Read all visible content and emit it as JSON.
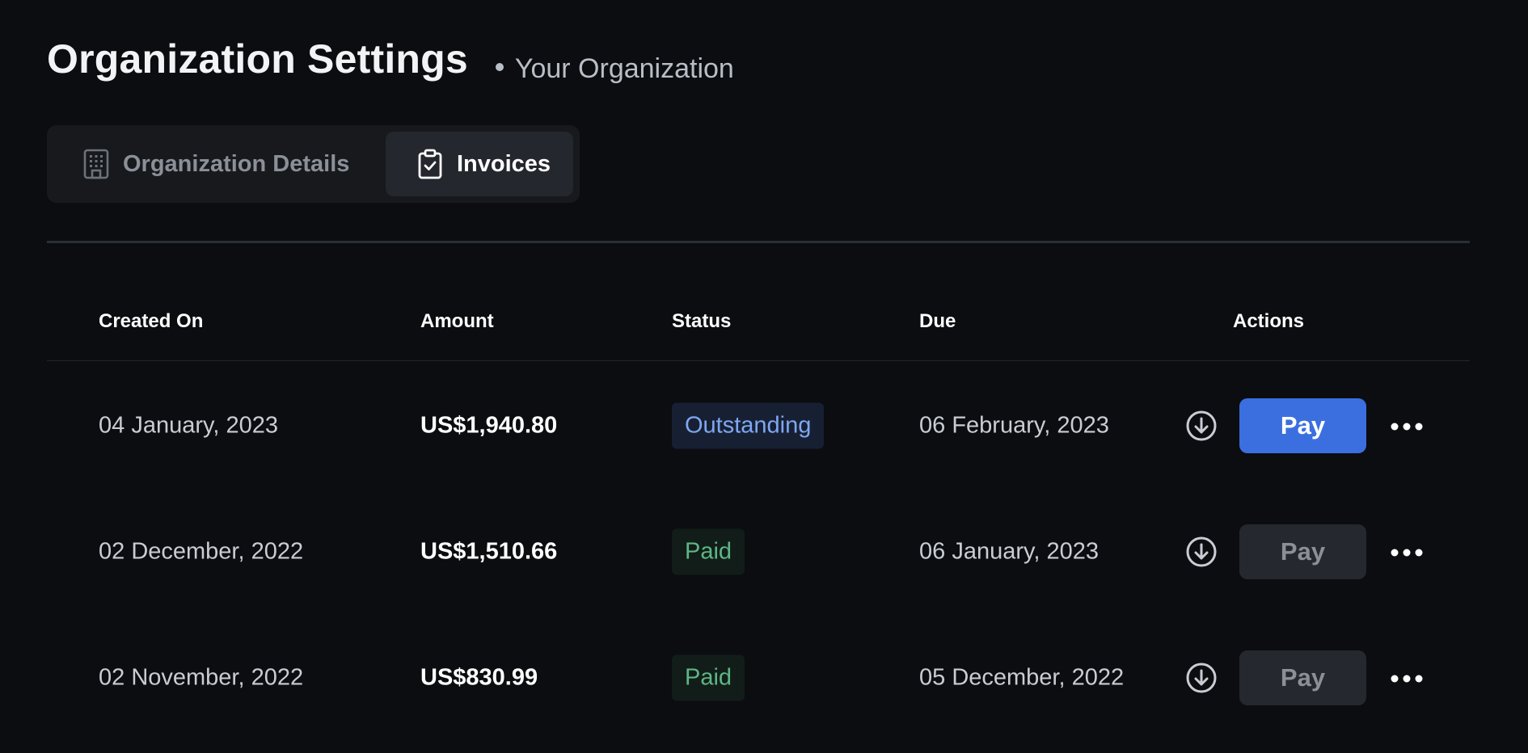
{
  "header": {
    "title": "Organization Settings",
    "organization": "Your Organization"
  },
  "tabs": [
    {
      "label": "Organization Details",
      "icon": "building-icon",
      "active": false
    },
    {
      "label": "Invoices",
      "icon": "clipboard-check-icon",
      "active": true
    }
  ],
  "table": {
    "columns": [
      "Created On",
      "Amount",
      "Status",
      "Due",
      "Actions"
    ],
    "rows": [
      {
        "created_on": "04 January, 2023",
        "amount": "US$1,940.80",
        "status": "Outstanding",
        "due": "06 February, 2023",
        "pay_label": "Pay",
        "pay_enabled": true
      },
      {
        "created_on": "02 December, 2022",
        "amount": "US$1,510.66",
        "status": "Paid",
        "due": "06 January, 2023",
        "pay_label": "Pay",
        "pay_enabled": false
      },
      {
        "created_on": "02 November, 2022",
        "amount": "US$830.99",
        "status": "Paid",
        "due": "05 December, 2022",
        "pay_label": "Pay",
        "pay_enabled": false
      }
    ]
  },
  "icons": {
    "download": "download-circle-icon",
    "more": "more-horizontal-icon"
  },
  "colors": {
    "background": "#0b0d10",
    "accent": "#3b6fe0",
    "outstanding_text": "#7fa7f2",
    "paid_text": "#5db685"
  }
}
